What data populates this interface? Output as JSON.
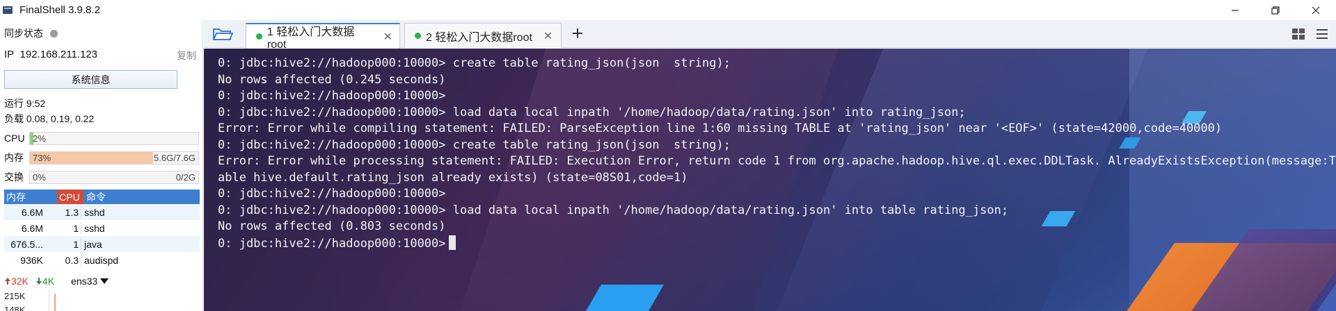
{
  "app": {
    "title": "FinalShell 3.9.8.2"
  },
  "sidebar": {
    "sync_label": "同步状态",
    "ip_label": "IP",
    "ip_value": "192.168.211.123",
    "copy_label": "复制",
    "sysinfo_label": "系统信息",
    "uptime": "运行 9:52",
    "load": "负载 0.08, 0.19, 0.22",
    "cpu": {
      "label": "CPU",
      "percent_text": "2%",
      "fill": 0.02,
      "color": "#8fcf7a"
    },
    "mem": {
      "label": "内存",
      "percent_text": "73%",
      "value": "5.6G/7.6G",
      "fill": 0.73,
      "color": "#f6c8a6"
    },
    "swap": {
      "label": "交换",
      "percent_text": "0%",
      "value": "0/2G",
      "fill": 0.0,
      "color": "#9fc4ef"
    },
    "processes": {
      "headers": [
        "内存",
        "CPU",
        "命令"
      ],
      "rows": [
        {
          "mem": "6.6M",
          "cpu": "1.3",
          "cmd": "sshd"
        },
        {
          "mem": "6.6M",
          "cpu": "1",
          "cmd": "sshd"
        },
        {
          "mem": "676.5...",
          "cpu": "1",
          "cmd": "java"
        },
        {
          "mem": "936K",
          "cpu": "0.3",
          "cmd": "audispd"
        }
      ]
    },
    "net": {
      "up": "32K",
      "down": "4K",
      "iface": "ens33"
    },
    "graph": {
      "label1": "215K",
      "label2": "148K"
    }
  },
  "tabs": [
    {
      "label": "1 轻松入门大数据root",
      "active": true
    },
    {
      "label": "2 轻松入门大数据root",
      "active": false
    }
  ],
  "terminal": {
    "lines": [
      "0: jdbc:hive2://hadoop000:10000> create table rating_json(json  string);",
      "No rows affected (0.245 seconds)",
      "0: jdbc:hive2://hadoop000:10000>",
      "0: jdbc:hive2://hadoop000:10000> load data local inpath '/home/hadoop/data/rating.json' into rating_json;",
      "Error: Error while compiling statement: FAILED: ParseException line 1:60 missing TABLE at 'rating_json' near '<EOF>' (state=42000,code=40000)",
      "0: jdbc:hive2://hadoop000:10000> create table rating_json(json  string);",
      "Error: Error while processing statement: FAILED: Execution Error, return code 1 from org.apache.hadoop.hive.ql.exec.DDLTask. AlreadyExistsException(message:T",
      "able hive.default.rating_json already exists) (state=08S01,code=1)",
      "0: jdbc:hive2://hadoop000:10000>",
      "0: jdbc:hive2://hadoop000:10000> load data local inpath '/home/hadoop/data/rating.json' into table rating_json;",
      "No rows affected (0.803 seconds)",
      "0: jdbc:hive2://hadoop000:10000>"
    ]
  }
}
